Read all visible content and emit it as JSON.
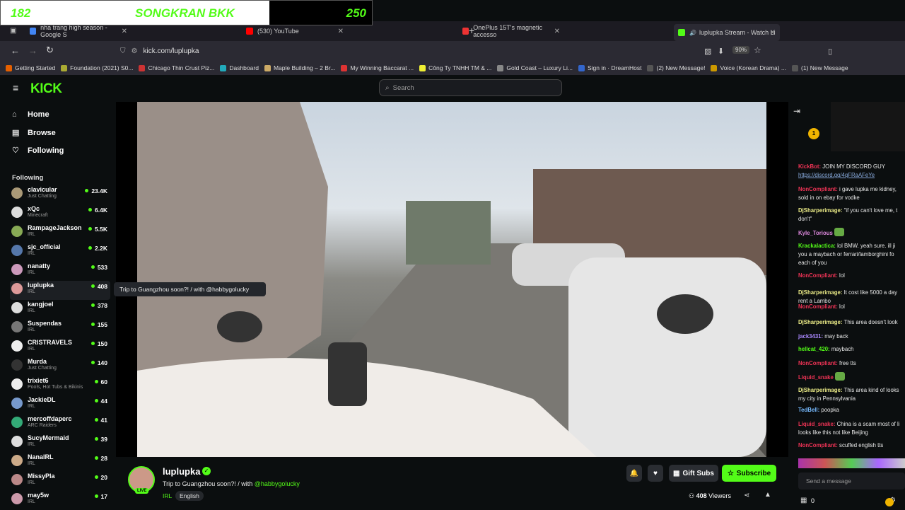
{
  "overlay": {
    "left_num": "182",
    "title": "SONGKRAN BKK",
    "right_num": "250"
  },
  "tabs": [
    {
      "label": "nha trang high season - Google S",
      "color": "#4285f4"
    },
    {
      "label": "(530) YouTube",
      "color": "#ff0000"
    },
    {
      "label": "OnePlus 15T's magnetic accesso",
      "color": "#e33"
    },
    {
      "label": "luplupka Stream - Watch Li",
      "color": "#53fc18"
    }
  ],
  "browser": {
    "url": "kick.com/luplupka",
    "zoom": "90%"
  },
  "bookmarks": [
    {
      "label": "Getting Started",
      "color": "#e66000"
    },
    {
      "label": "Foundation (2021) S0...",
      "color": "#aa3"
    },
    {
      "label": "Chicago Thin Crust Piz...",
      "color": "#c33"
    },
    {
      "label": "Dashboard",
      "color": "#2ab"
    },
    {
      "label": "Maple Building – 2 Br...",
      "color": "#ca6"
    },
    {
      "label": "My Winning Baccarat ...",
      "color": "#d33"
    },
    {
      "label": "Công Ty TNHH TM & ...",
      "color": "#ee3"
    },
    {
      "label": "Gold Coast – Luxury Li...",
      "color": "#888"
    },
    {
      "label": "Sign in · DreamHost",
      "color": "#36c"
    },
    {
      "label": "(2) New Message!",
      "color": "#555"
    },
    {
      "label": "Voice (Korean Drama) ...",
      "color": "#c90"
    },
    {
      "label": "(1) New Message",
      "color": "#555"
    }
  ],
  "kick": {
    "logo": "KICK",
    "search_placeholder": "Search"
  },
  "nav": {
    "home": "Home",
    "browse": "Browse",
    "following": "Following",
    "following_header": "Following"
  },
  "channels": [
    {
      "name": "clavicular",
      "cat": "Just Chatting",
      "viewers": "23.4K",
      "color": "#a97"
    },
    {
      "name": "xQc",
      "cat": "Minecraft",
      "viewers": "6.4K",
      "color": "#ddd"
    },
    {
      "name": "RampageJackson",
      "cat": "IRL",
      "viewers": "5.5K",
      "color": "#8a5"
    },
    {
      "name": "sjc_official",
      "cat": "IRL",
      "viewers": "2.2K",
      "color": "#57a"
    },
    {
      "name": "nanatty",
      "cat": "IRL",
      "viewers": "533",
      "color": "#c9b"
    },
    {
      "name": "luplupka",
      "cat": "IRL",
      "viewers": "408",
      "color": "#d99"
    },
    {
      "name": "kangjoel",
      "cat": "IRL",
      "viewers": "378",
      "color": "#ddd"
    },
    {
      "name": "Suspendas",
      "cat": "IRL",
      "viewers": "155",
      "color": "#777"
    },
    {
      "name": "CRISTRAVELS",
      "cat": "IRL",
      "viewers": "150",
      "color": "#eee"
    },
    {
      "name": "Murda",
      "cat": "Just Chatting",
      "viewers": "140",
      "color": "#333"
    },
    {
      "name": "trixiet6",
      "cat": "Pools, Hot Tubs & Bikinis",
      "viewers": "60",
      "color": "#eee"
    },
    {
      "name": "JackieDL",
      "cat": "IRL",
      "viewers": "44",
      "color": "#79c"
    },
    {
      "name": "mercoffdaperc",
      "cat": "ARC Raiders",
      "viewers": "41",
      "color": "#3a7"
    },
    {
      "name": "SucyMermaid",
      "cat": "IRL",
      "viewers": "39",
      "color": "#ddd"
    },
    {
      "name": "NanalRL",
      "cat": "IRL",
      "viewers": "28",
      "color": "#ca8"
    },
    {
      "name": "MissyPla",
      "cat": "IRL",
      "viewers": "20",
      "color": "#b88"
    },
    {
      "name": "may5w",
      "cat": "IRL",
      "viewers": "17",
      "color": "#c9a"
    }
  ],
  "tooltip": "Trip to Guangzhou soon?! / with @habbygolucky",
  "stream": {
    "name": "luplupka",
    "title_prefix": "Trip to Guangzhou soon?! / with ",
    "title_mention": "@habbygolucky",
    "live": "LIVE",
    "tag1": "IRL",
    "tag2": "English",
    "gift": "Gift Subs",
    "subscribe": "Subscribe",
    "viewers": "408",
    "viewers_label": "Viewers"
  },
  "chat": {
    "pinned_count": "1",
    "send_placeholder": "Send a message",
    "bottom_count": "0",
    "messages": [
      {
        "user": "KickBot",
        "text": "JOIN MY DISCORD GUY",
        "color": "#e35"
      },
      {
        "user": "",
        "text": "https://discord.gg/4qFRaAFeYe",
        "color": "#8ad"
      },
      {
        "user": "NonCompliant",
        "text": "i gave lupka me kidney, sold in on ebay for vodke",
        "color": "#e35"
      },
      {
        "user": "DjSharperimage",
        "text": "\"if you can't love me, t don't\"",
        "color": "#ee8"
      },
      {
        "user": "Kyle_Torious",
        "text": "",
        "color": "#d8d"
      },
      {
        "user": "Krackalactica",
        "text": "lol BMW. yeah sure. ill ji you a maybach or ferrari/lamborghini fo each of you",
        "color": "#53fc18"
      },
      {
        "user": "NonCompliant",
        "text": "lol",
        "color": "#e35"
      },
      {
        "user": "DjSharperimage",
        "text": "It cost like 5000 a day rent a Lambo",
        "color": "#ee8"
      },
      {
        "user": "NonCompliant",
        "text": "lol",
        "color": "#e35"
      },
      {
        "user": "DjSharperimage",
        "text": "This area doesn't look",
        "color": "#ee8"
      },
      {
        "user": "jack3431",
        "text": "may back",
        "color": "#a8f"
      },
      {
        "user": "hellcat_420",
        "text": "maybach",
        "color": "#53fc18"
      },
      {
        "user": "NonCompliant",
        "text": "free tts",
        "color": "#e35"
      },
      {
        "user": "Liquid_snake",
        "text": "",
        "color": "#e35"
      },
      {
        "user": "DjSharperimage",
        "text": "This area kind of looks my city in Pennsylvania",
        "color": "#ee8"
      },
      {
        "user": "TedBell",
        "text": "poopka",
        "color": "#7bf"
      },
      {
        "user": "Liquid_snake",
        "text": "China is a scam most of li looks like this not like Beijing",
        "color": "#e35"
      },
      {
        "user": "NonCompliant",
        "text": "scuffed english tts",
        "color": "#e35"
      }
    ]
  }
}
